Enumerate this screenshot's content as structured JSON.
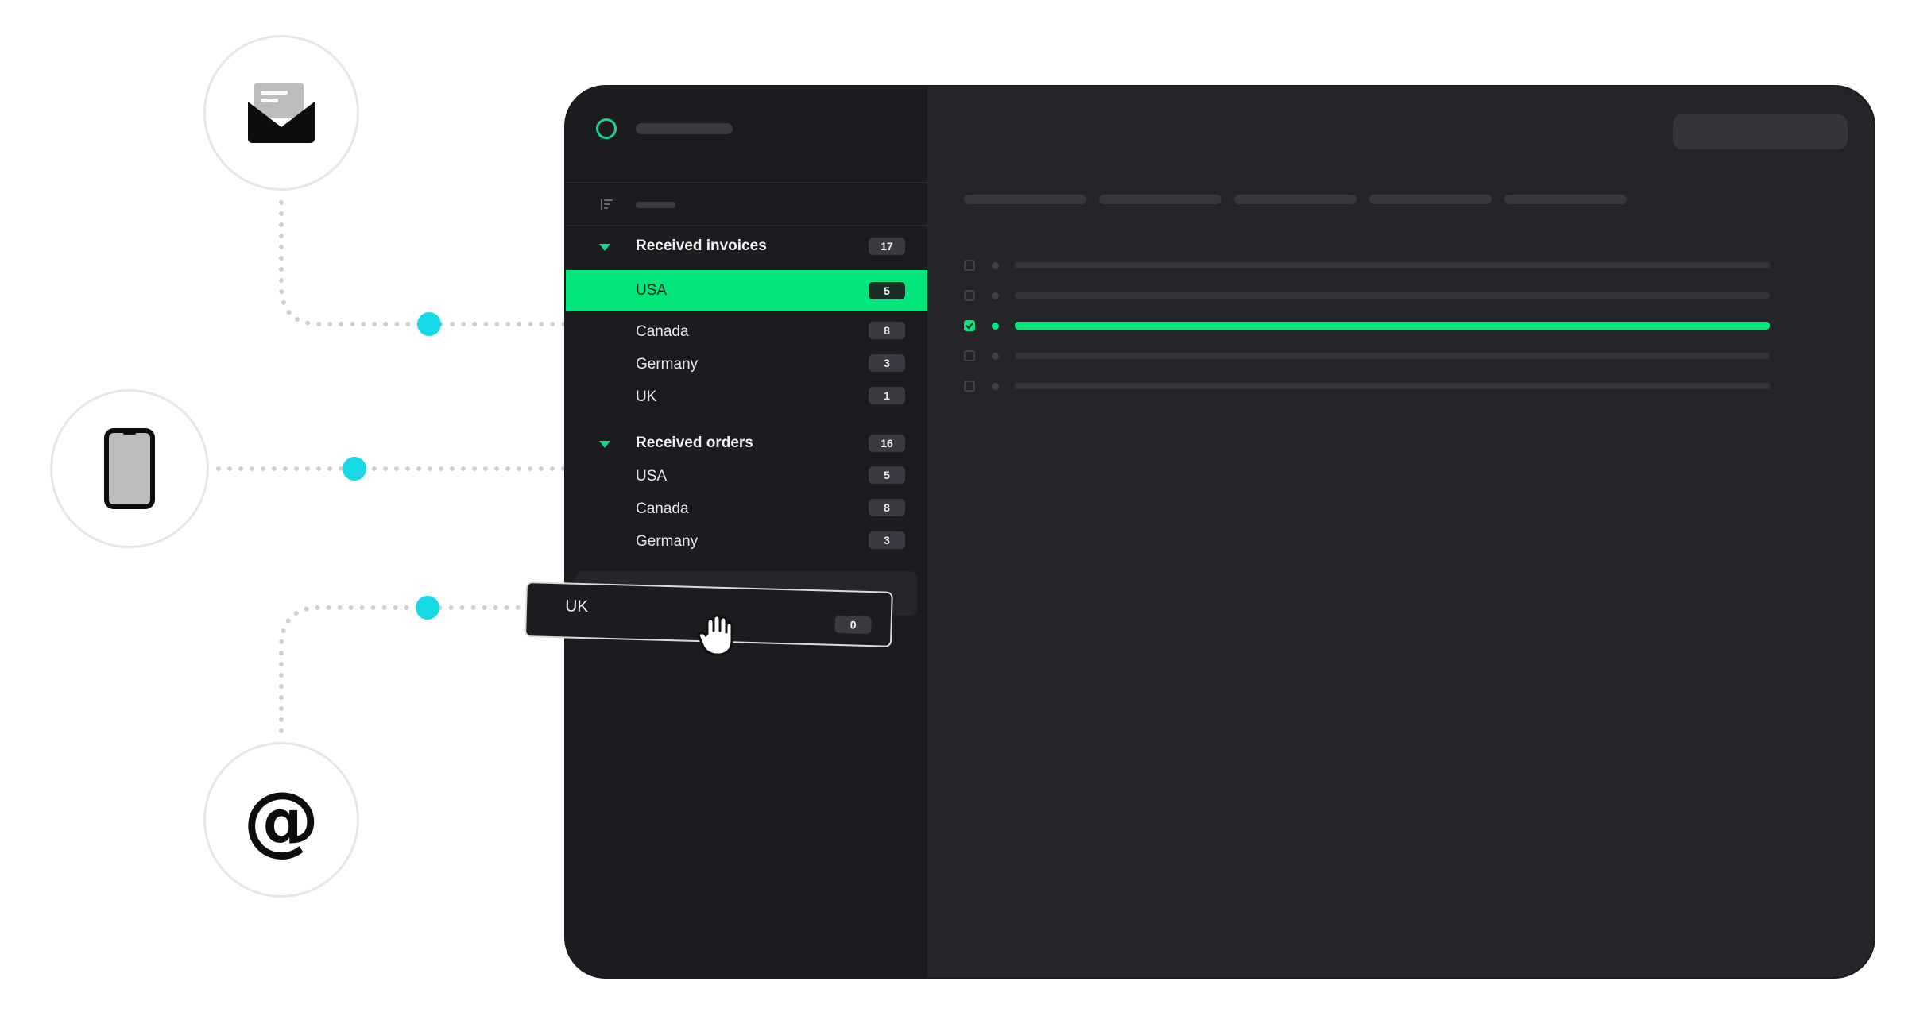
{
  "channels": [
    {
      "name": "email-channel",
      "icon": "envelope-icon"
    },
    {
      "name": "mobile-channel",
      "icon": "smartphone-icon"
    },
    {
      "name": "at-channel",
      "icon": "at-sign-icon",
      "glyph": "@"
    }
  ],
  "colors": {
    "accent": "#00e67a",
    "connector_dot": "#17d9e6",
    "sidebar_bg": "#1c1c20",
    "main_bg": "#252429"
  },
  "sidebar": {
    "groups": [
      {
        "title": "Received invoices",
        "count": "17",
        "items": [
          {
            "label": "USA",
            "count": "5",
            "active": true
          },
          {
            "label": "Canada",
            "count": "8"
          },
          {
            "label": "Germany",
            "count": "3"
          },
          {
            "label": "UK",
            "count": "1"
          }
        ]
      },
      {
        "title": "Received orders",
        "count": "16",
        "items": [
          {
            "label": "USA",
            "count": "5"
          },
          {
            "label": "Canada",
            "count": "8"
          },
          {
            "label": "Germany",
            "count": "3"
          }
        ]
      }
    ]
  },
  "dragged_item": {
    "label": "UK",
    "count": "0"
  },
  "rows": [
    {
      "checked": false
    },
    {
      "checked": false
    },
    {
      "checked": true
    },
    {
      "checked": false
    },
    {
      "checked": false
    }
  ]
}
